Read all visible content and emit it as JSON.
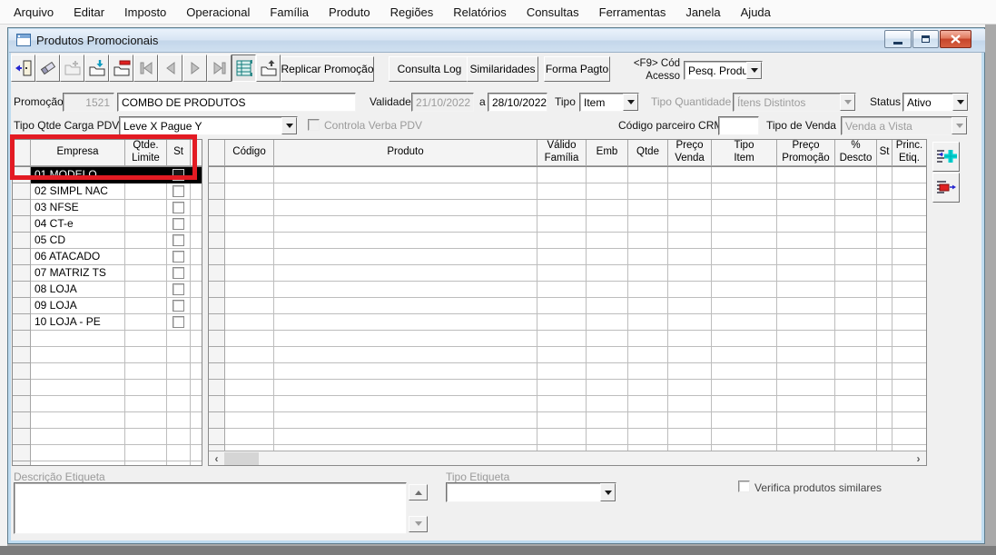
{
  "menu": {
    "items": [
      "Arquivo",
      "Editar",
      "Imposto",
      "Operacional",
      "Família",
      "Produto",
      "Regiões",
      "Relatórios",
      "Consultas",
      "Ferramentas",
      "Janela",
      "Ajuda"
    ]
  },
  "window": {
    "title": "Produtos Promocionais"
  },
  "toolbar": {
    "icon_buttons": [
      "exit",
      "erase",
      "add",
      "save",
      "delete",
      "first-record",
      "previous-record",
      "next-record",
      "last-record",
      "grid-view",
      "export"
    ],
    "text_buttons": [
      "Replicar Promoção",
      "Consulta Log",
      "Similaridades",
      "Forma Pagto"
    ],
    "f9_label_line1": "<F9> Cód",
    "f9_label_line2": "Acesso",
    "search_dropdown_value": "Pesq. Produtc"
  },
  "form": {
    "promocao_label": "Promoção",
    "promocao_numero": "1521",
    "promocao_nome": "COMBO DE PRODUTOS",
    "validade_label": "Validade",
    "validade_de": "21/10/2022",
    "validade_a_label": "a",
    "validade_ate": "28/10/2022",
    "tipo_label": "Tipo",
    "tipo_value": "Item",
    "tipo_quantidade_label": "Tipo Quantidade",
    "tipo_quantidade_value": "Ítens Distintos",
    "status_label": "Status",
    "status_value": "Ativo",
    "tipo_qtde_carga_pdv_label": "Tipo Qtde Carga PDV",
    "tipo_qtde_carga_pdv_value": "Leve X Pague Y",
    "controla_verba_pdv_label": "Controla Verba PDV",
    "codigo_parceiro_crm_label": "Código parceiro CRM",
    "codigo_parceiro_crm_value": "",
    "tipo_de_venda_label": "Tipo de Venda",
    "tipo_de_venda_value": "Venda a Vista"
  },
  "empresa_grid": {
    "columns": [
      "Empresa",
      "Qtde.\nLimite",
      "St"
    ],
    "rows": [
      "01 MODELO",
      "02 SIMPL NAC",
      "03 NFSE",
      "04 CT-e",
      "05 CD",
      "06 ATACADO",
      "07 MATRIZ TS",
      "08 LOJA",
      "09 LOJA",
      "10 LOJA - PE"
    ],
    "selected_row": "01 MODELO"
  },
  "produto_grid": {
    "columns": [
      "Código",
      "Produto",
      "Válido\nFamília",
      "Emb",
      "Qtde",
      "Preço\nVenda",
      "Tipo\nItem",
      "Preço\nPromoção",
      "%\nDescto",
      "St",
      "Princ.\nEtiq."
    ],
    "rows": []
  },
  "annotation": {
    "highlight_color": "#e31b23"
  },
  "footer": {
    "descricao_etiqueta_label": "Descrição Etiqueta",
    "descricao_etiqueta_value": "",
    "tipo_etiqueta_label": "Tipo Etiqueta",
    "tipo_etiqueta_value": "",
    "verifica_similares_label": "Verifica produtos similares"
  }
}
